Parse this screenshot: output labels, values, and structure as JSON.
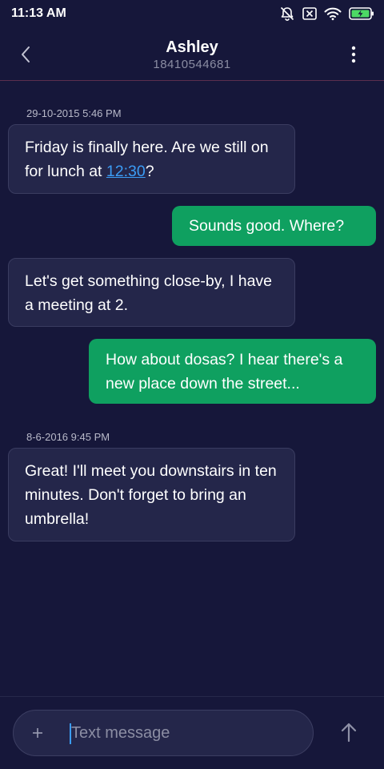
{
  "status_bar": {
    "time": "11:13 AM",
    "icons": [
      "notifications-off-icon",
      "no-sim-icon",
      "wifi-icon",
      "battery-charging-icon"
    ],
    "battery_color": "#4cd964"
  },
  "header": {
    "contact_name": "Ashley",
    "contact_number": "18410544681",
    "icons": [
      "back-arrow-icon",
      "more-vert-icon"
    ]
  },
  "conversation": {
    "timestamps": [
      "29-10-2015 5:46 PM",
      "8-6-2016 9:45 PM"
    ],
    "messages": [
      {
        "direction": "incoming",
        "text_before_link": "Friday is finally here. Are we still on for lunch at ",
        "link": "12:30",
        "text_after_link": "?"
      },
      {
        "direction": "outgoing",
        "text": "Sounds good. Where?"
      },
      {
        "direction": "incoming",
        "text": "Let's get something close-by, I have a meeting at 2."
      },
      {
        "direction": "outgoing",
        "text": "How about dosas? I hear there's a new place down the street..."
      },
      {
        "direction": "incoming",
        "text": "Great! I'll meet you downstairs in ten minutes. Don't forget to bring an umbrella!"
      }
    ]
  },
  "composer": {
    "placeholder": "Text message",
    "value": "",
    "icons": [
      "plus-icon",
      "send-arrow-icon"
    ]
  },
  "colors": {
    "background": "#16173a",
    "incoming_bubble": "#24264a",
    "outgoing_bubble": "#0fa060",
    "link": "#3b9cf5",
    "header_divider": "#5b2f4e"
  }
}
